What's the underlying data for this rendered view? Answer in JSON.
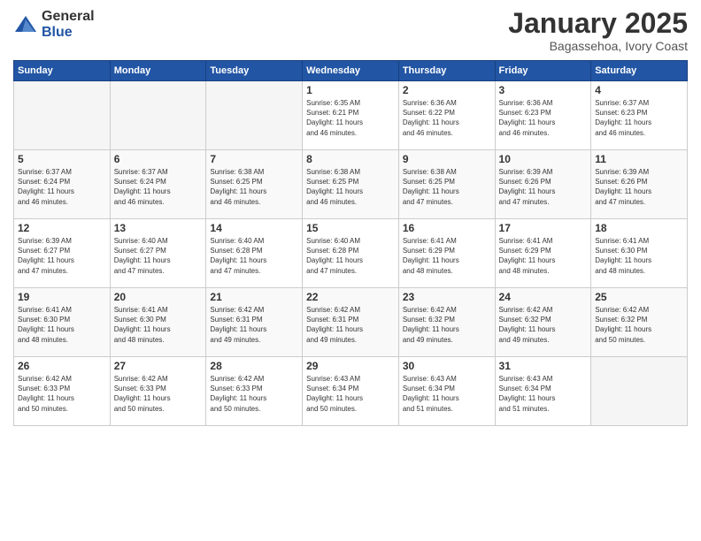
{
  "header": {
    "logo_general": "General",
    "logo_blue": "Blue",
    "month_title": "January 2025",
    "location": "Bagassehoa, Ivory Coast"
  },
  "weekdays": [
    "Sunday",
    "Monday",
    "Tuesday",
    "Wednesday",
    "Thursday",
    "Friday",
    "Saturday"
  ],
  "weeks": [
    [
      {
        "day": "",
        "info": ""
      },
      {
        "day": "",
        "info": ""
      },
      {
        "day": "",
        "info": ""
      },
      {
        "day": "1",
        "info": "Sunrise: 6:35 AM\nSunset: 6:21 PM\nDaylight: 11 hours\nand 46 minutes."
      },
      {
        "day": "2",
        "info": "Sunrise: 6:36 AM\nSunset: 6:22 PM\nDaylight: 11 hours\nand 46 minutes."
      },
      {
        "day": "3",
        "info": "Sunrise: 6:36 AM\nSunset: 6:23 PM\nDaylight: 11 hours\nand 46 minutes."
      },
      {
        "day": "4",
        "info": "Sunrise: 6:37 AM\nSunset: 6:23 PM\nDaylight: 11 hours\nand 46 minutes."
      }
    ],
    [
      {
        "day": "5",
        "info": "Sunrise: 6:37 AM\nSunset: 6:24 PM\nDaylight: 11 hours\nand 46 minutes."
      },
      {
        "day": "6",
        "info": "Sunrise: 6:37 AM\nSunset: 6:24 PM\nDaylight: 11 hours\nand 46 minutes."
      },
      {
        "day": "7",
        "info": "Sunrise: 6:38 AM\nSunset: 6:25 PM\nDaylight: 11 hours\nand 46 minutes."
      },
      {
        "day": "8",
        "info": "Sunrise: 6:38 AM\nSunset: 6:25 PM\nDaylight: 11 hours\nand 46 minutes."
      },
      {
        "day": "9",
        "info": "Sunrise: 6:38 AM\nSunset: 6:25 PM\nDaylight: 11 hours\nand 47 minutes."
      },
      {
        "day": "10",
        "info": "Sunrise: 6:39 AM\nSunset: 6:26 PM\nDaylight: 11 hours\nand 47 minutes."
      },
      {
        "day": "11",
        "info": "Sunrise: 6:39 AM\nSunset: 6:26 PM\nDaylight: 11 hours\nand 47 minutes."
      }
    ],
    [
      {
        "day": "12",
        "info": "Sunrise: 6:39 AM\nSunset: 6:27 PM\nDaylight: 11 hours\nand 47 minutes."
      },
      {
        "day": "13",
        "info": "Sunrise: 6:40 AM\nSunset: 6:27 PM\nDaylight: 11 hours\nand 47 minutes."
      },
      {
        "day": "14",
        "info": "Sunrise: 6:40 AM\nSunset: 6:28 PM\nDaylight: 11 hours\nand 47 minutes."
      },
      {
        "day": "15",
        "info": "Sunrise: 6:40 AM\nSunset: 6:28 PM\nDaylight: 11 hours\nand 47 minutes."
      },
      {
        "day": "16",
        "info": "Sunrise: 6:41 AM\nSunset: 6:29 PM\nDaylight: 11 hours\nand 48 minutes."
      },
      {
        "day": "17",
        "info": "Sunrise: 6:41 AM\nSunset: 6:29 PM\nDaylight: 11 hours\nand 48 minutes."
      },
      {
        "day": "18",
        "info": "Sunrise: 6:41 AM\nSunset: 6:30 PM\nDaylight: 11 hours\nand 48 minutes."
      }
    ],
    [
      {
        "day": "19",
        "info": "Sunrise: 6:41 AM\nSunset: 6:30 PM\nDaylight: 11 hours\nand 48 minutes."
      },
      {
        "day": "20",
        "info": "Sunrise: 6:41 AM\nSunset: 6:30 PM\nDaylight: 11 hours\nand 48 minutes."
      },
      {
        "day": "21",
        "info": "Sunrise: 6:42 AM\nSunset: 6:31 PM\nDaylight: 11 hours\nand 49 minutes."
      },
      {
        "day": "22",
        "info": "Sunrise: 6:42 AM\nSunset: 6:31 PM\nDaylight: 11 hours\nand 49 minutes."
      },
      {
        "day": "23",
        "info": "Sunrise: 6:42 AM\nSunset: 6:32 PM\nDaylight: 11 hours\nand 49 minutes."
      },
      {
        "day": "24",
        "info": "Sunrise: 6:42 AM\nSunset: 6:32 PM\nDaylight: 11 hours\nand 49 minutes."
      },
      {
        "day": "25",
        "info": "Sunrise: 6:42 AM\nSunset: 6:32 PM\nDaylight: 11 hours\nand 50 minutes."
      }
    ],
    [
      {
        "day": "26",
        "info": "Sunrise: 6:42 AM\nSunset: 6:33 PM\nDaylight: 11 hours\nand 50 minutes."
      },
      {
        "day": "27",
        "info": "Sunrise: 6:42 AM\nSunset: 6:33 PM\nDaylight: 11 hours\nand 50 minutes."
      },
      {
        "day": "28",
        "info": "Sunrise: 6:42 AM\nSunset: 6:33 PM\nDaylight: 11 hours\nand 50 minutes."
      },
      {
        "day": "29",
        "info": "Sunrise: 6:43 AM\nSunset: 6:34 PM\nDaylight: 11 hours\nand 50 minutes."
      },
      {
        "day": "30",
        "info": "Sunrise: 6:43 AM\nSunset: 6:34 PM\nDaylight: 11 hours\nand 51 minutes."
      },
      {
        "day": "31",
        "info": "Sunrise: 6:43 AM\nSunset: 6:34 PM\nDaylight: 11 hours\nand 51 minutes."
      },
      {
        "day": "",
        "info": ""
      }
    ]
  ]
}
